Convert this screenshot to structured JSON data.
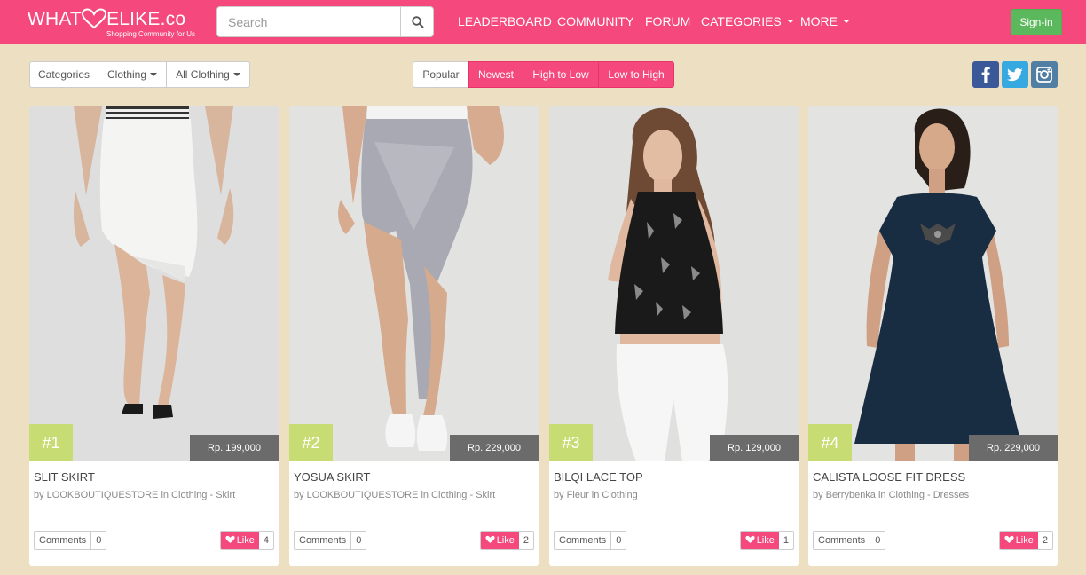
{
  "brand": {
    "logo_text": "WHAT",
    "logo_text_2": "ELIKE.co",
    "tagline": "Shopping Community for Us"
  },
  "search": {
    "placeholder": "Search",
    "icon": "search-icon"
  },
  "nav": {
    "leaderboard": "LEADERBOARD",
    "community": "COMMUNITY",
    "forum": "FORUM",
    "categories": "CATEGORIES",
    "more": "MORE",
    "signin": "Sign-in"
  },
  "filters": {
    "categories": "Categories",
    "clothing": "Clothing",
    "all_clothing": "All Clothing"
  },
  "sort": {
    "popular": "Popular",
    "newest": "Newest",
    "high_to_low": "High to Low",
    "low_to_high": "Low to High"
  },
  "social": [
    "facebook-icon",
    "twitter-icon",
    "instagram-icon"
  ],
  "colors": {
    "brand_pink": "#f5497d",
    "page_bg": "#ecdfc2",
    "rank_green": "#c7dd73",
    "signin_green": "#5cb85c"
  },
  "products": [
    {
      "rank": "#1",
      "price": "Rp. 199,000",
      "title": "SLIT SKIRT",
      "meta": "by LOOKBOUTIQUESTORE in Clothing - Skirt",
      "comments_label": "Comments",
      "comments": "0",
      "like_label": "Like",
      "likes": "4"
    },
    {
      "rank": "#2",
      "price": "Rp. 229,000",
      "title": "YOSUA SKIRT",
      "meta": "by LOOKBOUTIQUESTORE in Clothing - Skirt",
      "comments_label": "Comments",
      "comments": "0",
      "like_label": "Like",
      "likes": "2"
    },
    {
      "rank": "#3",
      "price": "Rp. 129,000",
      "title": "BILQI LACE TOP",
      "meta": "by Fleur in Clothing",
      "comments_label": "Comments",
      "comments": "0",
      "like_label": "Like",
      "likes": "1"
    },
    {
      "rank": "#4",
      "price": "Rp. 229,000",
      "title": "CALISTA LOOSE FIT DRESS",
      "meta": "by Berrybenka in Clothing - Dresses",
      "comments_label": "Comments",
      "comments": "0",
      "like_label": "Like",
      "likes": "2"
    }
  ]
}
